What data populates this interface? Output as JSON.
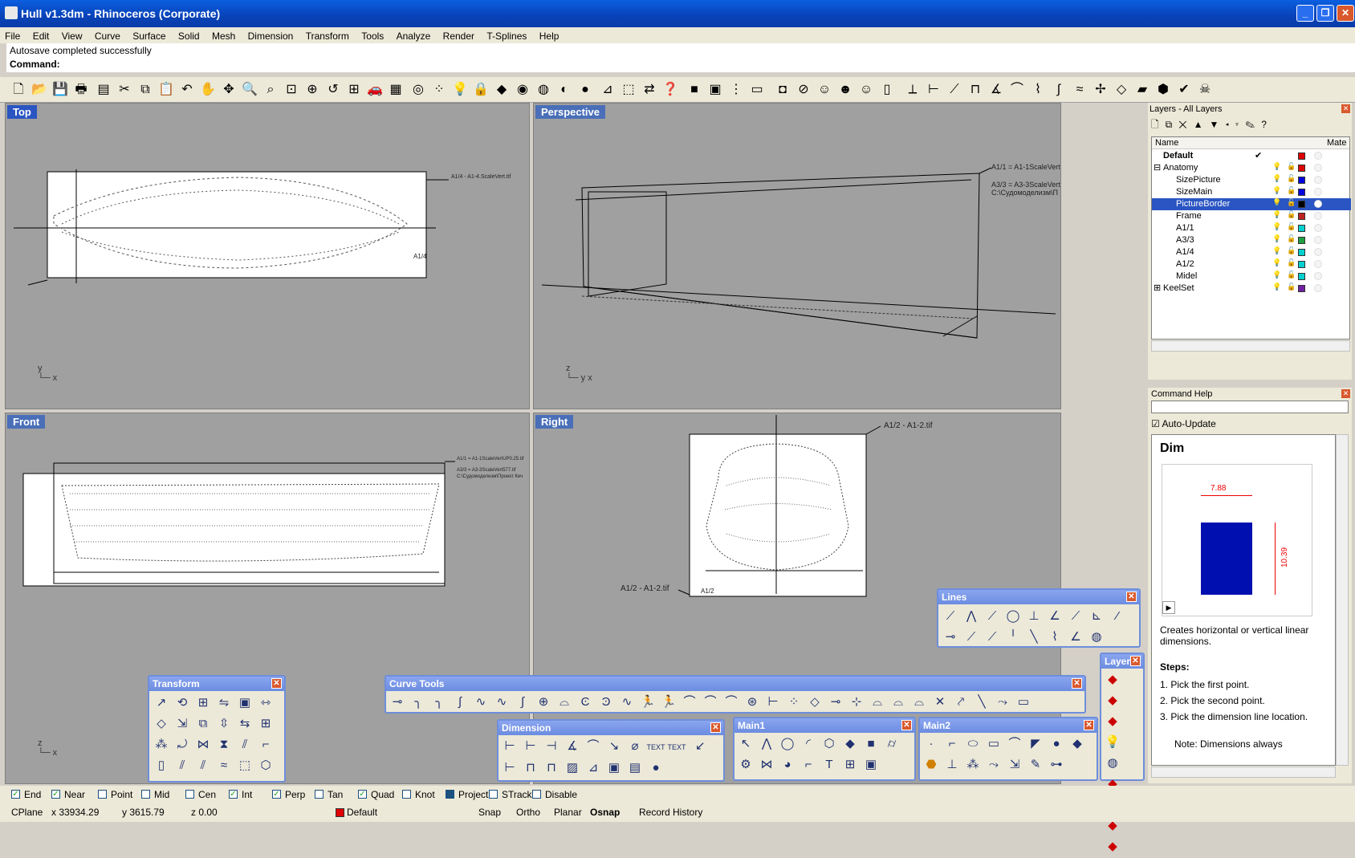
{
  "window": {
    "title": "Hull v1.3dm - Rhinoceros (Corporate)"
  },
  "menu": [
    "File",
    "Edit",
    "View",
    "Curve",
    "Surface",
    "Solid",
    "Mesh",
    "Dimension",
    "Transform",
    "Tools",
    "Analyze",
    "Render",
    "T-Splines",
    "Help"
  ],
  "command_history": "Autosave completed successfully",
  "command_prompt": "Command:",
  "viewports": {
    "top": "Top",
    "perspective": "Perspective",
    "front": "Front",
    "right": "Right"
  },
  "annotations": {
    "top_a": "A1/4 - A1-4.ScaleVert.tif",
    "top_b": "A1/4",
    "persp_a": "A1/1 = A1-1ScaleVert",
    "persp_b": "A3/3 = A3-3ScaleVert",
    "persp_c": "C:\\Судомоделизм\\П",
    "front_a": "A1/1 = A1-1ScaleVertUP0.25.tif",
    "front_b": "A3/3 = A3-3ScaleVert577.tif",
    "front_c": "C:\\Судомоделизм\\Проект Кеч",
    "right_a": "A1/2 - A1-2.tif",
    "right_b": "A1/2 - A1-2.tif",
    "right_c": "A1/2"
  },
  "layers": {
    "title": "Layers - All Layers",
    "col_name": "Name",
    "col_mat": "Mate",
    "items": [
      {
        "name": "Default",
        "color": "#e00000"
      },
      {
        "name": "Anatomy",
        "color": "#e00000"
      },
      {
        "name": "SizePicture",
        "color": "#0000e0"
      },
      {
        "name": "SizeMain",
        "color": "#0000e0"
      },
      {
        "name": "PictureBorder",
        "color": "#000000"
      },
      {
        "name": "Frame",
        "color": "#c02020"
      },
      {
        "name": "A1/1",
        "color": "#00d0d0"
      },
      {
        "name": "A3/3",
        "color": "#20a040"
      },
      {
        "name": "A1/4",
        "color": "#00d0d0"
      },
      {
        "name": "A1/2",
        "color": "#00d0d0"
      },
      {
        "name": "Midel",
        "color": "#00d0d0"
      },
      {
        "name": "KeelSet",
        "color": "#7020a0"
      }
    ]
  },
  "help": {
    "title": "Command Help",
    "auto_update": "Auto-Update",
    "heading": "Dim",
    "dim_value": "7.88",
    "dim_value2": "10.39",
    "desc": "Creates horizontal or vertical linear dimensions.",
    "steps_label": "Steps:",
    "step1": "Pick the first point.",
    "step2": "Pick the second point.",
    "step3": "Pick the dimension line location.",
    "note": "Note: Dimensions always"
  },
  "toolbars": {
    "lines": "Lines",
    "transform": "Transform",
    "curve_tools": "Curve Tools",
    "dimension": "Dimension",
    "main1": "Main1",
    "main2": "Main2",
    "layer": "Layer"
  },
  "osnap": [
    "End",
    "Near",
    "Point",
    "Mid",
    "Cen",
    "Int",
    "Perp",
    "Tan",
    "Quad",
    "Knot",
    "Project",
    "STrack",
    "Disable"
  ],
  "osnap_checked": [
    true,
    true,
    false,
    false,
    false,
    true,
    true,
    false,
    true,
    false,
    true,
    false,
    false
  ],
  "status": {
    "cplane": "CPlane",
    "x": "x 33934.29",
    "y": "y 3615.79",
    "z": "z 0.00",
    "layer": "Default",
    "snap": "Snap",
    "ortho": "Ortho",
    "planar": "Planar",
    "osnap": "Osnap",
    "record": "Record History"
  }
}
